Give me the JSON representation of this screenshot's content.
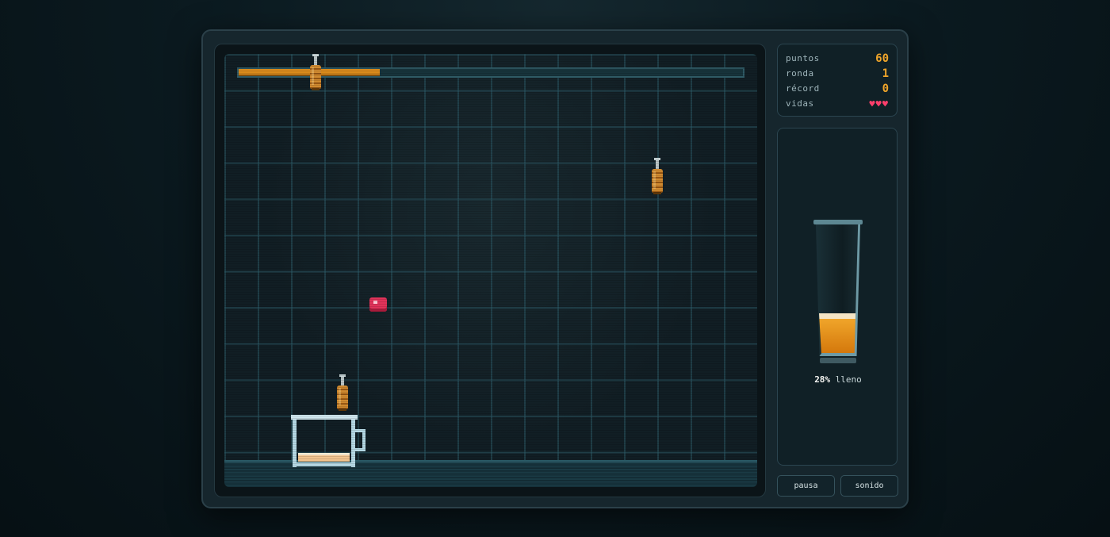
{
  "hud": {
    "points_label": "puntos",
    "points_value": "60",
    "round_label": "ronda",
    "round_value": "1",
    "record_label": "récord",
    "record_value": "0",
    "lives_label": "vidas",
    "lives_value": "♥♥♥"
  },
  "round_progress": 0.28,
  "glass": {
    "fill_percent": "28%",
    "fill_suffix": " lleno"
  },
  "buttons": {
    "pause": "pausa",
    "sound": "sonido"
  },
  "colors": {
    "accent": "#f0a52a",
    "lives": "#ff3f6c",
    "beer": "#d98a1c"
  }
}
